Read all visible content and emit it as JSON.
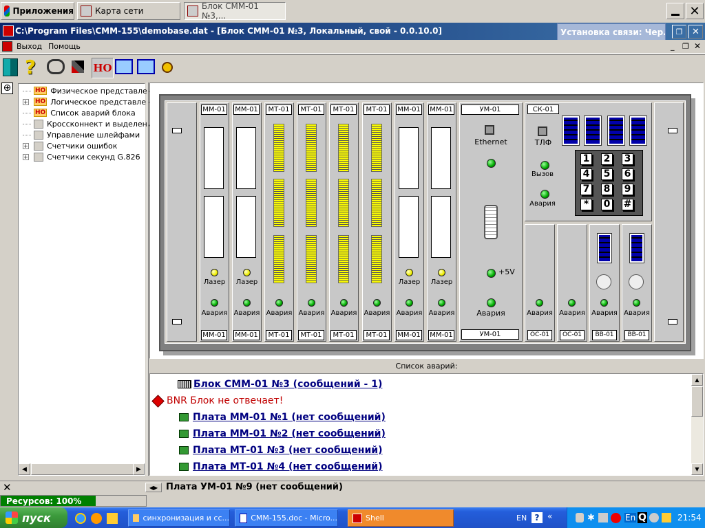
{
  "top_tabs": [
    {
      "label": "Приложения"
    },
    {
      "label": "Карта сети"
    },
    {
      "label": "Блок СММ-01 №3,..."
    }
  ],
  "window": {
    "title": "C:\\Program Files\\CMM-155\\demobase.dat - [Блок СММ-01 №3, Локальный, свой - 0.0.10.0]",
    "popup_title": "Установка связи: Чер..."
  },
  "menu": {
    "exit": "Выход",
    "help": "Помощь"
  },
  "toolbar": {
    "ho_label": "НО"
  },
  "tree": {
    "badge": "НО",
    "items": [
      {
        "label": "Физическое представлени"
      },
      {
        "label": "Логическое представление"
      },
      {
        "label": "Список аварий блока"
      },
      {
        "label": "Кроссконнект и выделение"
      },
      {
        "label": "Управление шлейфами"
      },
      {
        "label": "Счетчики ошибок"
      },
      {
        "label": "Счетчики секунд G.826"
      }
    ]
  },
  "rack": {
    "cards": [
      {
        "top": "ММ-01",
        "bottom": "ММ-01",
        "type": "mm"
      },
      {
        "top": "ММ-01",
        "bottom": "ММ-01",
        "type": "mm"
      },
      {
        "top": "МТ-01",
        "bottom": "МТ-01",
        "type": "mt"
      },
      {
        "top": "МТ-01",
        "bottom": "МТ-01",
        "type": "mt"
      },
      {
        "top": "МТ-01",
        "bottom": "МТ-01",
        "type": "mt"
      },
      {
        "top": "МТ-01",
        "bottom": "МТ-01",
        "type": "mt"
      },
      {
        "top": "ММ-01",
        "bottom": "ММ-01",
        "type": "mm"
      },
      {
        "top": "ММ-01",
        "bottom": "ММ-01",
        "type": "mm"
      }
    ],
    "laser": "Лазер",
    "alarm": "Авария",
    "um": {
      "top": "УМ-01",
      "bottom": "УМ-01",
      "ethernet": "Ethernet",
      "plus5v": "+5V",
      "alarm": "Авария"
    },
    "sk": {
      "title": "СК-01",
      "tlf": "ТЛФ",
      "call": "Вызов",
      "alarm": "Авария"
    },
    "keys": [
      "1",
      "2",
      "3",
      "4",
      "5",
      "6",
      "7",
      "8",
      "9",
      "*",
      "0",
      "#"
    ],
    "small_cards": [
      {
        "label": "ОС-01",
        "alarm": "Авария"
      },
      {
        "label": "ОС-01",
        "alarm": "Авария"
      },
      {
        "label": "ВВ-01",
        "alarm": "Авария"
      },
      {
        "label": "ВВ-01",
        "alarm": "Авария"
      }
    ]
  },
  "alarms": {
    "header": "Список аварий:",
    "rows": [
      {
        "text": "Блок СММ-01 №3 (сообщений - 1)",
        "kind": "block"
      },
      {
        "text": "BNR Блок не отвечает!",
        "kind": "error"
      },
      {
        "text": "Плата ММ-01 №1 (нет сообщений)",
        "kind": "board"
      },
      {
        "text": "Плата ММ-01 №2 (нет сообщений)",
        "kind": "board"
      },
      {
        "text": "Плата МТ-01 №3 (нет сообщений)",
        "kind": "board"
      },
      {
        "text": "Плата МТ-01 №4 (нет сообщений)",
        "kind": "board"
      }
    ]
  },
  "status": {
    "current_item": "Плата УМ-01 №9 (нет сообщений)",
    "resources": "Ресурсов: 100%"
  },
  "taskbar": {
    "start": "пуск",
    "tasks": [
      {
        "label": "синхронизация и сс..."
      },
      {
        "label": "CMM-155.doc - Micro..."
      },
      {
        "label": "Shell"
      }
    ],
    "lang": "EN",
    "tray_lang": "En",
    "clock": "21:54"
  },
  "colors": {
    "title_bar": "#0a246a",
    "link": "#000080",
    "error": "#c00000",
    "taskbar": "#245edb",
    "start": "#3c9b3c",
    "led_green": "#00b000",
    "led_yellow": "#eeee00",
    "connector": "#ffff00",
    "resources_bar": "#008000"
  }
}
